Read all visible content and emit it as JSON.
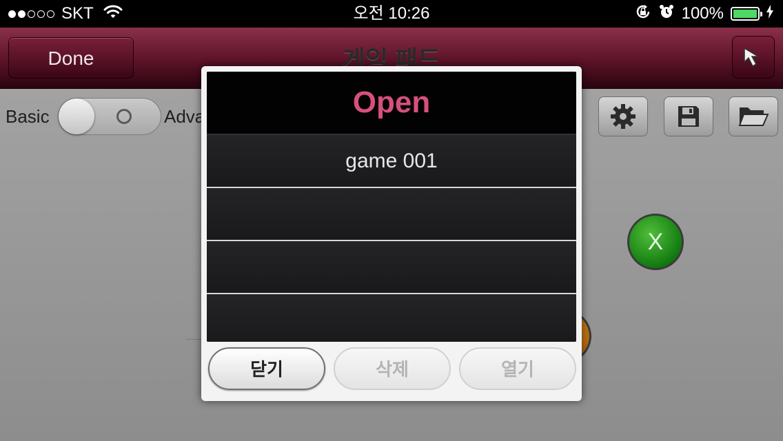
{
  "status_bar": {
    "carrier": "SKT",
    "time": "오전 10:26",
    "battery": "100%",
    "signal_bars_filled": 2,
    "signal_bars_total": 5,
    "icons": [
      "wifi-icon",
      "rotation-lock-icon",
      "alarm-icon",
      "battery-icon",
      "charging-icon"
    ]
  },
  "navbar": {
    "done_label": "Done",
    "title": "게임 패드",
    "pointer_icon": "cursor-arrow-icon"
  },
  "controls": {
    "basic_label": "Basic",
    "advanced_label_visible": "Adva",
    "toggle_state": "basic",
    "tool_icons": [
      "gear-icon",
      "save-icon",
      "folder-open-icon"
    ],
    "x_button_label": "X"
  },
  "dialog": {
    "title": "Open",
    "items": [
      "game 001",
      "",
      "",
      ""
    ],
    "buttons": {
      "close": "닫기",
      "delete": "삭제",
      "open": "열기"
    }
  },
  "colors": {
    "accent_title": "#d6507c",
    "navbar_top": "#8a2f4a",
    "navbar_bottom": "#2a040f",
    "battery_fill": "#4cd964",
    "x_button": "#137a10"
  }
}
